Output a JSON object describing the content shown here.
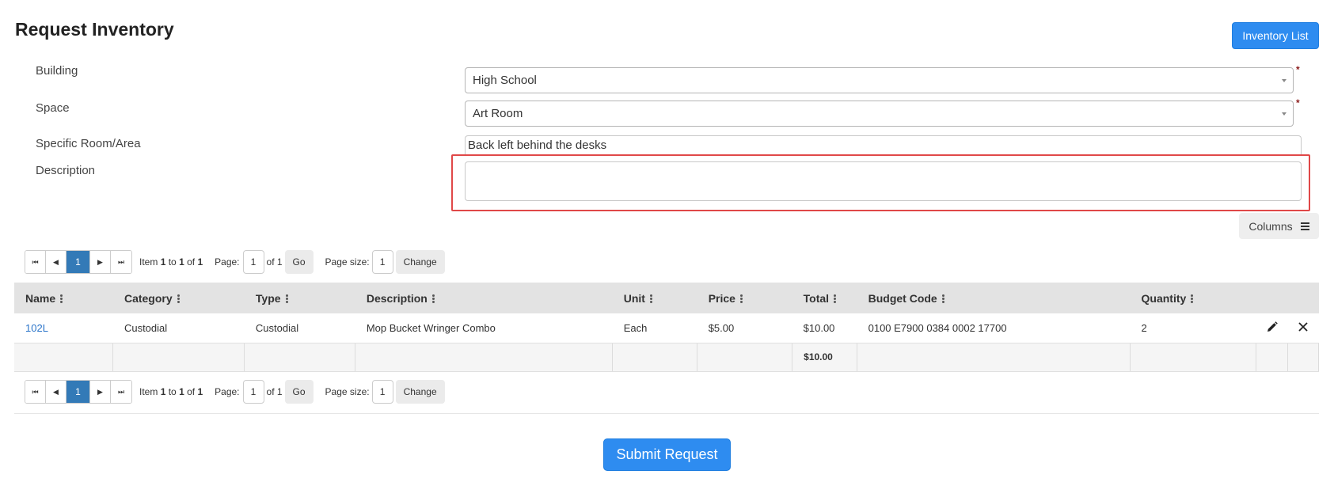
{
  "header": {
    "title": "Request Inventory",
    "inventory_list_label": "Inventory List"
  },
  "form": {
    "building_label": "Building",
    "building_value": "High School",
    "space_label": "Space",
    "space_value": "Art Room",
    "room_label": "Specific Room/Area",
    "room_value": "Back left behind the desks",
    "description_label": "Description",
    "description_value": "",
    "required_mark": "*"
  },
  "toolbar": {
    "columns_label": "Columns"
  },
  "pager": {
    "current_page": "1",
    "item_prefix": "Item",
    "item_from": "1",
    "item_to_word": "to",
    "item_to": "1",
    "item_of_word": "of",
    "item_total": "1",
    "page_label": "Page:",
    "page_value": "1",
    "page_of": "of 1",
    "go_label": "Go",
    "size_label": "Page size:",
    "size_value": "1",
    "change_label": "Change"
  },
  "table": {
    "headers": [
      "Name",
      "Category",
      "Type",
      "Description",
      "Unit",
      "Price",
      "Total",
      "Budget Code",
      "Quantity"
    ],
    "rows": [
      {
        "name": "102L",
        "category": "Custodial",
        "type": "Custodial",
        "description": "Mop Bucket Wringer Combo",
        "unit": "Each",
        "price": "$5.00",
        "total": "$10.00",
        "budget_code": "0100 E7900 0384 0002 17700",
        "quantity": "2"
      }
    ],
    "footer_total": "$10.00"
  },
  "icons": {
    "edit": "pencil-icon",
    "delete": "close-icon",
    "columns": "menu-icon"
  },
  "actions": {
    "submit_label": "Submit Request"
  },
  "colors": {
    "primary": "#2e8cf0",
    "pager_active": "#337ab7",
    "highlight": "#e04848",
    "link": "#2a74c9"
  }
}
